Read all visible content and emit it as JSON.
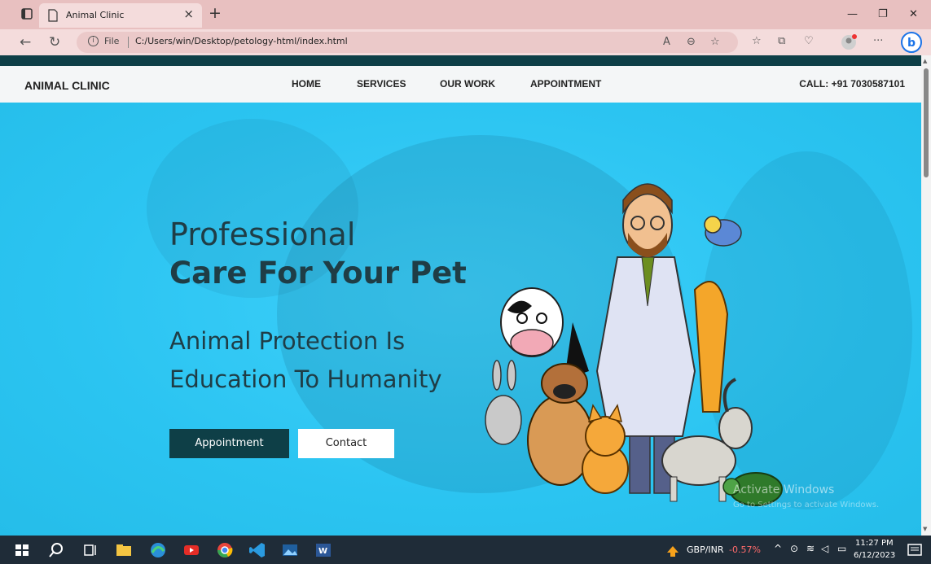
{
  "browser": {
    "tab_title": "Animal Clinic",
    "tab_close": "×",
    "new_tab": "+",
    "file_label": "File",
    "url": "C:/Users/win/Desktop/petology-html/index.html"
  },
  "nav": {
    "brand": "ANIMAL CLINIC",
    "items": [
      "HOME",
      "SERVICES",
      "OUR WORK",
      "APPOINTMENT"
    ],
    "call": "CALL: +91 7030587101"
  },
  "hero": {
    "line1": "Professional",
    "line2": "Care For Your Pet",
    "sub1": "Animal Protection Is",
    "sub2": "Education To Humanity",
    "btn_appointment": "Appointment",
    "btn_contact": "Contact"
  },
  "watermark": {
    "title": "Activate Windows",
    "subtitle": "Go to Settings to activate Windows."
  },
  "taskbar": {
    "ticker_pair": "GBP/INR",
    "ticker_change": "-0.57%",
    "time": "11:27 PM",
    "date": "6/12/2023"
  },
  "colors": {
    "hero_bg": "#2fc6f3",
    "dark_teal": "#0e3f47",
    "heading_text": "#1f3d46"
  }
}
